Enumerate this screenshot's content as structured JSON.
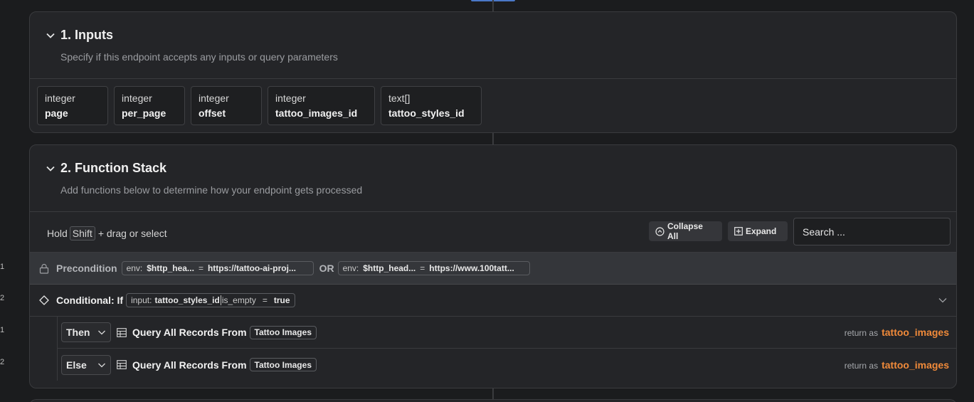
{
  "inputs_section": {
    "title": "1. Inputs",
    "subtitle": "Specify if this endpoint accepts any inputs or query parameters",
    "items": [
      {
        "type": "integer",
        "name": "page"
      },
      {
        "type": "integer",
        "name": "per_page"
      },
      {
        "type": "integer",
        "name": "offset"
      },
      {
        "type": "integer",
        "name": "tattoo_images_id"
      },
      {
        "type": "text[]",
        "name": "tattoo_styles_id"
      }
    ]
  },
  "function_stack": {
    "title": "2. Function Stack",
    "subtitle": "Add functions below to determine how your endpoint gets processed",
    "hold_prefix": "Hold",
    "hold_key": "Shift",
    "hold_suffix": "+ drag or select",
    "collapse_all_label": "Collapse All",
    "expand_label": "Expand",
    "search_placeholder": "Search ..."
  },
  "precondition": {
    "label": "Precondition",
    "line_number": "1",
    "left_pill": {
      "prefix": "env:",
      "var": "$http_hea...",
      "op": "=",
      "value": "https://tattoo-ai-proj..."
    },
    "or_label": "OR",
    "right_pill": {
      "prefix": "env:",
      "var": "$http_head...",
      "op": "=",
      "value": "https://www.100tatt..."
    }
  },
  "conditional": {
    "line_number": "2",
    "label": "Conditional: If",
    "input_prefix": "input:",
    "input_var": "tattoo_styles_id",
    "filter": "is_empty",
    "op": "=",
    "value": "true"
  },
  "branches": [
    {
      "line_number": "1",
      "select": "Then",
      "query_label": "Query All Records From",
      "table": "Tattoo Images",
      "return_as": "return as",
      "return_var": "tattoo_images"
    },
    {
      "line_number": "2",
      "select": "Else",
      "query_label": "Query All Records From",
      "table": "Tattoo Images",
      "return_as": "return as",
      "return_var": "tattoo_images"
    }
  ]
}
